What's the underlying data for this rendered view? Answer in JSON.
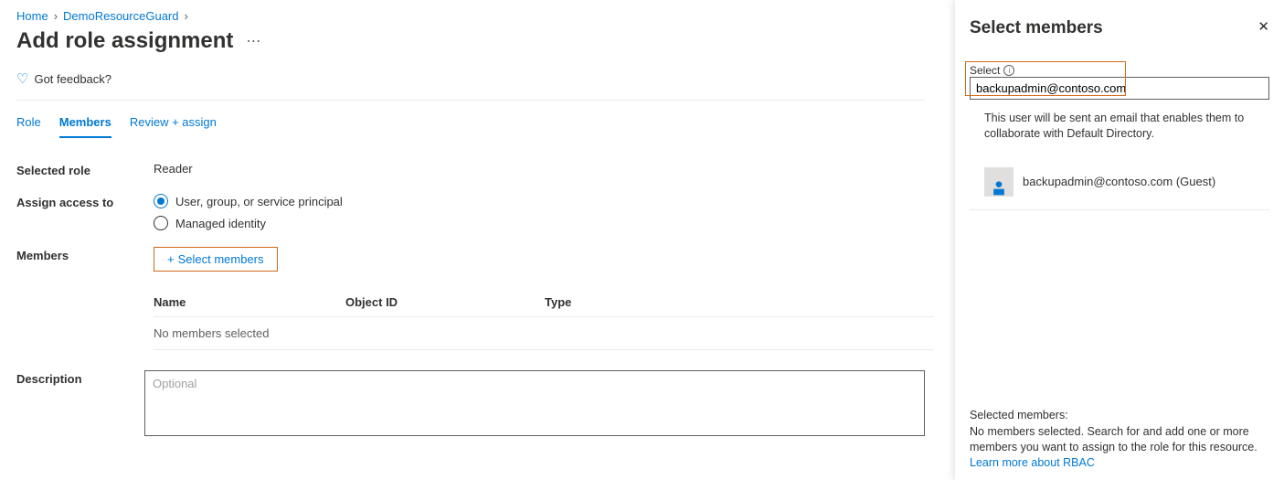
{
  "breadcrumb": {
    "home": "Home",
    "resource": "DemoResourceGuard"
  },
  "page": {
    "title": "Add role assignment",
    "feedback": "Got feedback?"
  },
  "tabs": {
    "role": "Role",
    "members": "Members",
    "review": "Review + assign"
  },
  "form": {
    "selected_role_label": "Selected role",
    "selected_role_value": "Reader",
    "assign_access_label": "Assign access to",
    "radio_user": "User, group, or service principal",
    "radio_mi": "Managed identity",
    "members_label": "Members",
    "select_members_link": "Select members",
    "table_headers": {
      "name": "Name",
      "object_id": "Object ID",
      "type": "Type"
    },
    "no_members": "No members selected",
    "description_label": "Description",
    "description_placeholder": "Optional"
  },
  "flyout": {
    "title": "Select members",
    "select_label": "Select",
    "search_value": "backupadmin@contoso.com",
    "help_text": "This user will be sent an email that enables them to collaborate with Default Directory.",
    "result_name": "backupadmin@contoso.com (Guest)",
    "footer_label": "Selected members:",
    "footer_text": "No members selected. Search for and add one or more members you want to assign to the role for this resource.",
    "learn_more": "Learn more about RBAC"
  }
}
